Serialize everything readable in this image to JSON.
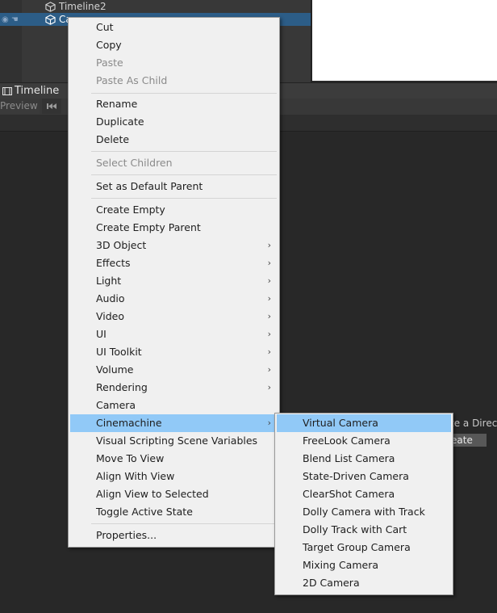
{
  "hierarchy": {
    "rows": [
      {
        "label": "Timeline2"
      },
      {
        "label": "Ca"
      }
    ]
  },
  "timeline": {
    "tab_label": "Timeline",
    "preview_label": "Preview"
  },
  "background_text": {
    "directive_hint": "te a Direc",
    "create_button": "eate"
  },
  "context_menu": {
    "items": [
      {
        "label": "Cut",
        "enabled": true
      },
      {
        "label": "Copy",
        "enabled": true
      },
      {
        "label": "Paste",
        "enabled": false
      },
      {
        "label": "Paste As Child",
        "enabled": false
      },
      {
        "label": "Rename",
        "enabled": true
      },
      {
        "label": "Duplicate",
        "enabled": true
      },
      {
        "label": "Delete",
        "enabled": true
      },
      {
        "label": "Select Children",
        "enabled": false
      },
      {
        "label": "Set as Default Parent",
        "enabled": true
      },
      {
        "label": "Create Empty",
        "enabled": true
      },
      {
        "label": "Create Empty Parent",
        "enabled": true
      },
      {
        "label": "3D Object",
        "enabled": true,
        "submenu": true
      },
      {
        "label": "Effects",
        "enabled": true,
        "submenu": true
      },
      {
        "label": "Light",
        "enabled": true,
        "submenu": true
      },
      {
        "label": "Audio",
        "enabled": true,
        "submenu": true
      },
      {
        "label": "Video",
        "enabled": true,
        "submenu": true
      },
      {
        "label": "UI",
        "enabled": true,
        "submenu": true
      },
      {
        "label": "UI Toolkit",
        "enabled": true,
        "submenu": true
      },
      {
        "label": "Volume",
        "enabled": true,
        "submenu": true
      },
      {
        "label": "Rendering",
        "enabled": true,
        "submenu": true
      },
      {
        "label": "Camera",
        "enabled": true
      },
      {
        "label": "Cinemachine",
        "enabled": true,
        "submenu": true,
        "highlighted": true
      },
      {
        "label": "Visual Scripting Scene Variables",
        "enabled": true
      },
      {
        "label": "Move To View",
        "enabled": true
      },
      {
        "label": "Align With View",
        "enabled": true
      },
      {
        "label": "Align View to Selected",
        "enabled": true
      },
      {
        "label": "Toggle Active State",
        "enabled": true
      },
      {
        "label": "Properties...",
        "enabled": true
      }
    ],
    "submenu_arrow": "›"
  },
  "cinemachine_submenu": {
    "items": [
      {
        "label": "Virtual Camera",
        "highlighted": true
      },
      {
        "label": "FreeLook Camera"
      },
      {
        "label": "Blend List Camera"
      },
      {
        "label": "State-Driven Camera"
      },
      {
        "label": "ClearShot Camera"
      },
      {
        "label": "Dolly Camera with Track"
      },
      {
        "label": "Dolly Track with Cart"
      },
      {
        "label": "Target Group Camera"
      },
      {
        "label": "Mixing Camera"
      },
      {
        "label": "2D Camera"
      }
    ]
  },
  "colors": {
    "menu_bg": "#f0f0f0",
    "highlight": "#91c9f7",
    "selection_row": "#2c5d87",
    "editor_bg": "#282828"
  }
}
